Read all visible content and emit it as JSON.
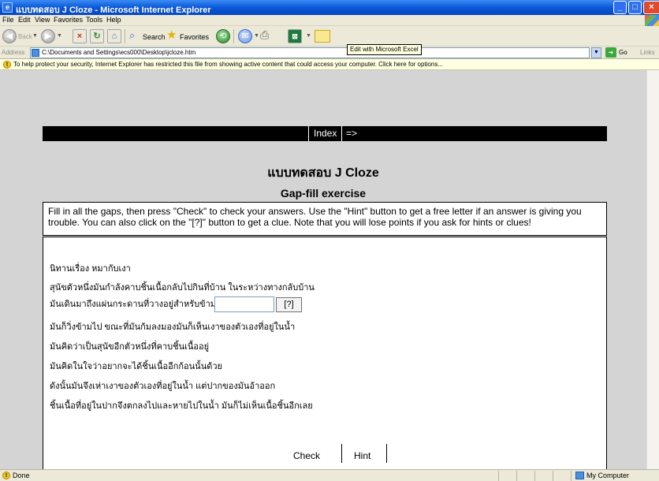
{
  "window": {
    "title": "แบบทดสอบ J Cloze - Microsoft Internet Explorer",
    "min": "_",
    "max": "□",
    "close": "×"
  },
  "menu": [
    "File",
    "Edit",
    "View",
    "Favorites",
    "Tools",
    "Help"
  ],
  "toolbar": {
    "back": "Back",
    "search": "Search",
    "favorites": "Favorites",
    "tooltip": "Edit with Microsoft Excel"
  },
  "address": {
    "label": "Address",
    "value": "C:\\Documents and Settings\\ecs000\\Desktop\\jcloze.htm",
    "go": "Go",
    "links": "Links"
  },
  "infobar": "To help protect your security, Internet Explorer has restricted this file from showing active content that could access your computer. Click here for options...",
  "nav": {
    "index": "Index",
    "next": "=>"
  },
  "exercise": {
    "title": "แบบทดสอบ J Cloze",
    "subtitle": "Gap-fill exercise",
    "instructions": "Fill in all the gaps, then press \"Check\" to check your answers. Use the \"Hint\" button to get a free letter if an answer is giving you trouble. You can also click on the \"[?]\" button to get a clue. Note that you will lose points if you ask for hints or clues!",
    "story": [
      "นิทานเรื่อง หมากับเงา",
      "สุนัขตัวหนึ่งมันกำลังคาบชิ้นเนื้อกลับไปกินที่บ้าน ในระหว่างทางกลับบ้าน",
      "มันเดินมาถึงแผ่นกระดานที่วางอยู่สำหรับข้าม",
      "มันก็วิ่งข้ามไป ขณะที่มันก้มลงมองมันก็เห็นเงาของตัวเองที่อยู่ในน้ำ",
      "มันคิดว่าเป็นสุนัขอีกตัวหนึ่งที่คาบชิ้นเนื้ออยู่",
      "มันคิดในใจว่าอยากจะได้ชิ้นเนื้ออีกก้อนนั้นด้วย",
      "ดังนั้นมันจึงเห่าเงาของตัวเองที่อยู่ในน้ำ แต่ปากของมันอ้าออก",
      "ชิ้นเนื้อที่อยู่ในปากจึงตกลงไปและหายไปในน้ำ มันก็ไม่เห็นเนื้อชิ้นอีกเลย"
    ],
    "clue_label": "[?]",
    "check": "Check",
    "hint": "Hint"
  },
  "status": {
    "text": "Done",
    "zone": "My Computer"
  }
}
